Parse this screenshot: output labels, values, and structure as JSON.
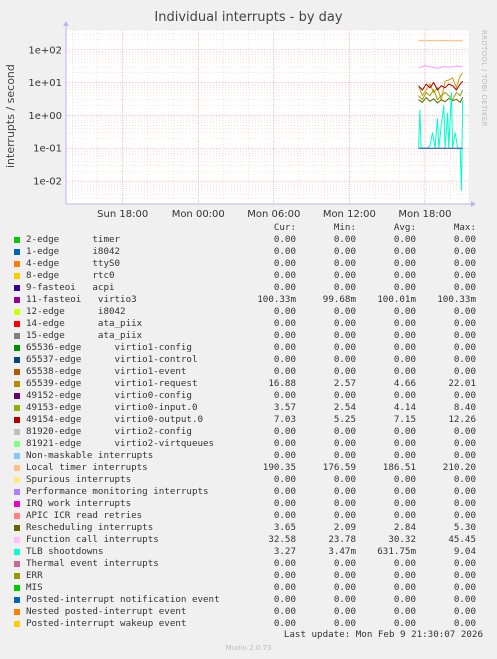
{
  "chart_data": {
    "type": "line",
    "title": "Individual interrupts - by day",
    "ylabel": "interrupts / second",
    "yscale": "log",
    "ylim": [
      0.002,
      400
    ],
    "y_tick_labels": [
      "1e+02",
      "1e+01",
      "1e+00",
      "1e-01",
      "1e-02"
    ],
    "y_tick_values": [
      100,
      10,
      1,
      0.1,
      0.01
    ],
    "x_tick_labels": [
      "Sun 18:00",
      "Mon 00:00",
      "Mon 06:00",
      "Mon 12:00",
      "Mon 18:00"
    ],
    "x_tick_hours": [
      18,
      24,
      30,
      36,
      42
    ],
    "xlim_hours": [
      13.5,
      45.5
    ],
    "data_start_hour": 41.5,
    "grid": true,
    "side_credit": "RRDTOOL / TOBI OETIKER",
    "series_curves": [
      {
        "name": "Local timer interrupts",
        "color": "#ffbb77",
        "points": [
          [
            41.5,
            190
          ],
          [
            42,
            188
          ],
          [
            42.5,
            192
          ],
          [
            43,
            189
          ],
          [
            43.5,
            191
          ],
          [
            44,
            187
          ],
          [
            44.5,
            190
          ],
          [
            45,
            189
          ]
        ]
      },
      {
        "name": "Function call interrupts",
        "color": "#ff99ff",
        "points": [
          [
            41.5,
            28
          ],
          [
            42,
            33
          ],
          [
            42.5,
            30
          ],
          [
            43,
            27
          ],
          [
            43.5,
            31
          ],
          [
            44,
            29
          ],
          [
            44.5,
            32
          ],
          [
            45,
            30
          ]
        ]
      },
      {
        "name": "virtio1-request",
        "color": "#cc9900",
        "points": [
          [
            41.5,
            8
          ],
          [
            41.8,
            4
          ],
          [
            42.1,
            6
          ],
          [
            42.4,
            9
          ],
          [
            42.7,
            5
          ],
          [
            43,
            7
          ],
          [
            43.3,
            3
          ],
          [
            43.6,
            11
          ],
          [
            43.9,
            12
          ],
          [
            44.2,
            14
          ],
          [
            44.5,
            7
          ],
          [
            44.8,
            16
          ],
          [
            45,
            20
          ]
        ]
      },
      {
        "name": "virtio0-output.0",
        "color": "#990000",
        "points": [
          [
            41.5,
            8
          ],
          [
            41.8,
            6
          ],
          [
            42.1,
            9
          ],
          [
            42.4,
            7
          ],
          [
            42.7,
            10
          ],
          [
            43,
            6
          ],
          [
            43.3,
            8
          ],
          [
            43.6,
            7
          ],
          [
            43.9,
            9
          ],
          [
            44.2,
            8
          ],
          [
            44.5,
            6
          ],
          [
            44.8,
            9
          ],
          [
            45,
            11
          ]
        ]
      },
      {
        "name": "virtio0-input.0",
        "color": "#8fa000",
        "points": [
          [
            41.5,
            4
          ],
          [
            41.8,
            3
          ],
          [
            42.1,
            5
          ],
          [
            42.4,
            4
          ],
          [
            42.7,
            6
          ],
          [
            43,
            3
          ],
          [
            43.3,
            4
          ],
          [
            43.6,
            5
          ],
          [
            43.9,
            4
          ],
          [
            44.2,
            3
          ],
          [
            44.5,
            5
          ],
          [
            44.8,
            4
          ],
          [
            45,
            6
          ]
        ]
      },
      {
        "name": "Rescheduling interrupts",
        "color": "#556b00",
        "points": [
          [
            41.5,
            3
          ],
          [
            41.8,
            2.5
          ],
          [
            42.1,
            3.5
          ],
          [
            42.4,
            2.7
          ],
          [
            42.7,
            3.2
          ],
          [
            43,
            2.4
          ],
          [
            43.3,
            3
          ],
          [
            43.6,
            2.6
          ],
          [
            43.9,
            3.3
          ],
          [
            44.2,
            2.8
          ],
          [
            44.5,
            3.1
          ],
          [
            44.8,
            2.5
          ],
          [
            45,
            3.6
          ]
        ]
      },
      {
        "name": "TLB shootdowns",
        "color": "#00ffcc",
        "points": [
          [
            41.5,
            0.1
          ],
          [
            41.6,
            1.5
          ],
          [
            41.7,
            0.1
          ],
          [
            41.9,
            0.1
          ],
          [
            42.2,
            0.1
          ],
          [
            42.4,
            0.12
          ],
          [
            42.6,
            0.3
          ],
          [
            42.8,
            0.1
          ],
          [
            43.0,
            0.8
          ],
          [
            43.1,
            0.1
          ],
          [
            43.3,
            0.5
          ],
          [
            43.5,
            2
          ],
          [
            43.6,
            0.1
          ],
          [
            43.8,
            1.2
          ],
          [
            43.9,
            0.1
          ],
          [
            44.1,
            5
          ],
          [
            44.2,
            0.1
          ],
          [
            44.4,
            0.3
          ],
          [
            44.6,
            0.1
          ],
          [
            44.8,
            0.1
          ],
          [
            44.9,
            0.005
          ],
          [
            45,
            3
          ]
        ]
      },
      {
        "name": "virtio3",
        "color": "#1f3fc0",
        "points": [
          [
            41.5,
            0.1
          ],
          [
            42.5,
            0.1
          ],
          [
            43.5,
            0.1
          ],
          [
            44.5,
            0.1
          ],
          [
            45,
            0.1
          ]
        ]
      }
    ]
  },
  "legend": {
    "headers": [
      "Cur:",
      "Min:",
      "Avg:",
      "Max:"
    ],
    "rows": [
      {
        "name": "2-edge      timer",
        "color": "#00cc00",
        "cur": "0.00",
        "min": "0.00",
        "avg": "0.00",
        "max": "0.00"
      },
      {
        "name": "1-edge      i8042",
        "color": "#0066b3",
        "cur": "0.00",
        "min": "0.00",
        "avg": "0.00",
        "max": "0.00"
      },
      {
        "name": "4-edge      ttyS0",
        "color": "#ff8000",
        "cur": "0.00",
        "min": "0.00",
        "avg": "0.00",
        "max": "0.00"
      },
      {
        "name": "8-edge      rtc0",
        "color": "#ffcc00",
        "cur": "0.00",
        "min": "0.00",
        "avg": "0.00",
        "max": "0.00"
      },
      {
        "name": "9-fasteoi   acpi",
        "color": "#330099",
        "cur": "0.00",
        "min": "0.00",
        "avg": "0.00",
        "max": "0.00"
      },
      {
        "name": "11-fasteoi   virtio3",
        "color": "#990099",
        "cur": "100.33m",
        "min": "99.68m",
        "avg": "100.01m",
        "max": "100.33m"
      },
      {
        "name": "12-edge      i8042",
        "color": "#ccff00",
        "cur": "0.00",
        "min": "0.00",
        "avg": "0.00",
        "max": "0.00"
      },
      {
        "name": "14-edge      ata_piix",
        "color": "#ff0000",
        "cur": "0.00",
        "min": "0.00",
        "avg": "0.00",
        "max": "0.00"
      },
      {
        "name": "15-edge      ata_piix",
        "color": "#808080",
        "cur": "0.00",
        "min": "0.00",
        "avg": "0.00",
        "max": "0.00"
      },
      {
        "name": "65536-edge      virtio1-config",
        "color": "#008f00",
        "cur": "0.00",
        "min": "0.00",
        "avg": "0.00",
        "max": "0.00"
      },
      {
        "name": "65537-edge      virtio1-control",
        "color": "#00487d",
        "cur": "0.00",
        "min": "0.00",
        "avg": "0.00",
        "max": "0.00"
      },
      {
        "name": "65538-edge      virtio1-event",
        "color": "#b35a00",
        "cur": "0.00",
        "min": "0.00",
        "avg": "0.00",
        "max": "0.00"
      },
      {
        "name": "65539-edge      virtio1-request",
        "color": "#b38f00",
        "cur": "16.88",
        "min": "2.57",
        "avg": "4.66",
        "max": "22.01"
      },
      {
        "name": "49152-edge      virtio0-config",
        "color": "#6b006b",
        "cur": "0.00",
        "min": "0.00",
        "avg": "0.00",
        "max": "0.00"
      },
      {
        "name": "49153-edge      virtio0-input.0",
        "color": "#8fb300",
        "cur": "3.57",
        "min": "2.54",
        "avg": "4.14",
        "max": "8.40"
      },
      {
        "name": "49154-edge      virtio0-output.0",
        "color": "#b30000",
        "cur": "7.03",
        "min": "5.25",
        "avg": "7.15",
        "max": "12.26"
      },
      {
        "name": "81920-edge      virtio2-config",
        "color": "#bebebe",
        "cur": "0.00",
        "min": "0.00",
        "avg": "0.00",
        "max": "0.00"
      },
      {
        "name": "81921-edge      virtio2-virtqueues",
        "color": "#80ff80",
        "cur": "0.00",
        "min": "0.00",
        "avg": "0.00",
        "max": "0.00"
      },
      {
        "name": "Non-maskable interrupts",
        "color": "#80c9ff",
        "cur": "0.00",
        "min": "0.00",
        "avg": "0.00",
        "max": "0.00"
      },
      {
        "name": "Local timer interrupts",
        "color": "#ffc080",
        "cur": "190.35",
        "min": "176.59",
        "avg": "186.51",
        "max": "210.20"
      },
      {
        "name": "Spurious interrupts",
        "color": "#ffe680",
        "cur": "0.00",
        "min": "0.00",
        "avg": "0.00",
        "max": "0.00"
      },
      {
        "name": "Performance monitoring interrupts",
        "color": "#aa80ff",
        "cur": "0.00",
        "min": "0.00",
        "avg": "0.00",
        "max": "0.00"
      },
      {
        "name": "IRQ work interrupts",
        "color": "#ee00cc",
        "cur": "0.00",
        "min": "0.00",
        "avg": "0.00",
        "max": "0.00"
      },
      {
        "name": "APIC ICR read retries",
        "color": "#ff8080",
        "cur": "0.00",
        "min": "0.00",
        "avg": "0.00",
        "max": "0.00"
      },
      {
        "name": "Rescheduling interrupts",
        "color": "#666600",
        "cur": "3.65",
        "min": "2.09",
        "avg": "2.84",
        "max": "5.30"
      },
      {
        "name": "Function call interrupts",
        "color": "#ffbfff",
        "cur": "32.58",
        "min": "23.78",
        "avg": "30.32",
        "max": "45.45"
      },
      {
        "name": "TLB shootdowns",
        "color": "#00ffcc",
        "cur": "3.27",
        "min": "3.47m",
        "avg": "631.75m",
        "max": "9.04"
      },
      {
        "name": "Thermal event interrupts",
        "color": "#cc6699",
        "cur": "0.00",
        "min": "0.00",
        "avg": "0.00",
        "max": "0.00"
      },
      {
        "name": "ERR",
        "color": "#999900",
        "cur": "0.00",
        "min": "0.00",
        "avg": "0.00",
        "max": "0.00"
      },
      {
        "name": "MIS",
        "color": "#00cc00",
        "cur": "0.00",
        "min": "0.00",
        "avg": "0.00",
        "max": "0.00"
      },
      {
        "name": "Posted-interrupt notification event",
        "color": "#0066b3",
        "cur": "0.00",
        "min": "0.00",
        "avg": "0.00",
        "max": "0.00"
      },
      {
        "name": "Nested posted-interrupt event",
        "color": "#ff8000",
        "cur": "0.00",
        "min": "0.00",
        "avg": "0.00",
        "max": "0.00"
      },
      {
        "name": "Posted-interrupt wakeup event",
        "color": "#ffcc00",
        "cur": "0.00",
        "min": "0.00",
        "avg": "0.00",
        "max": "0.00"
      }
    ]
  },
  "footer": {
    "last_update": "Last update: Mon Feb  9 21:30:07 2026",
    "version": "Munin 2.0.73"
  }
}
